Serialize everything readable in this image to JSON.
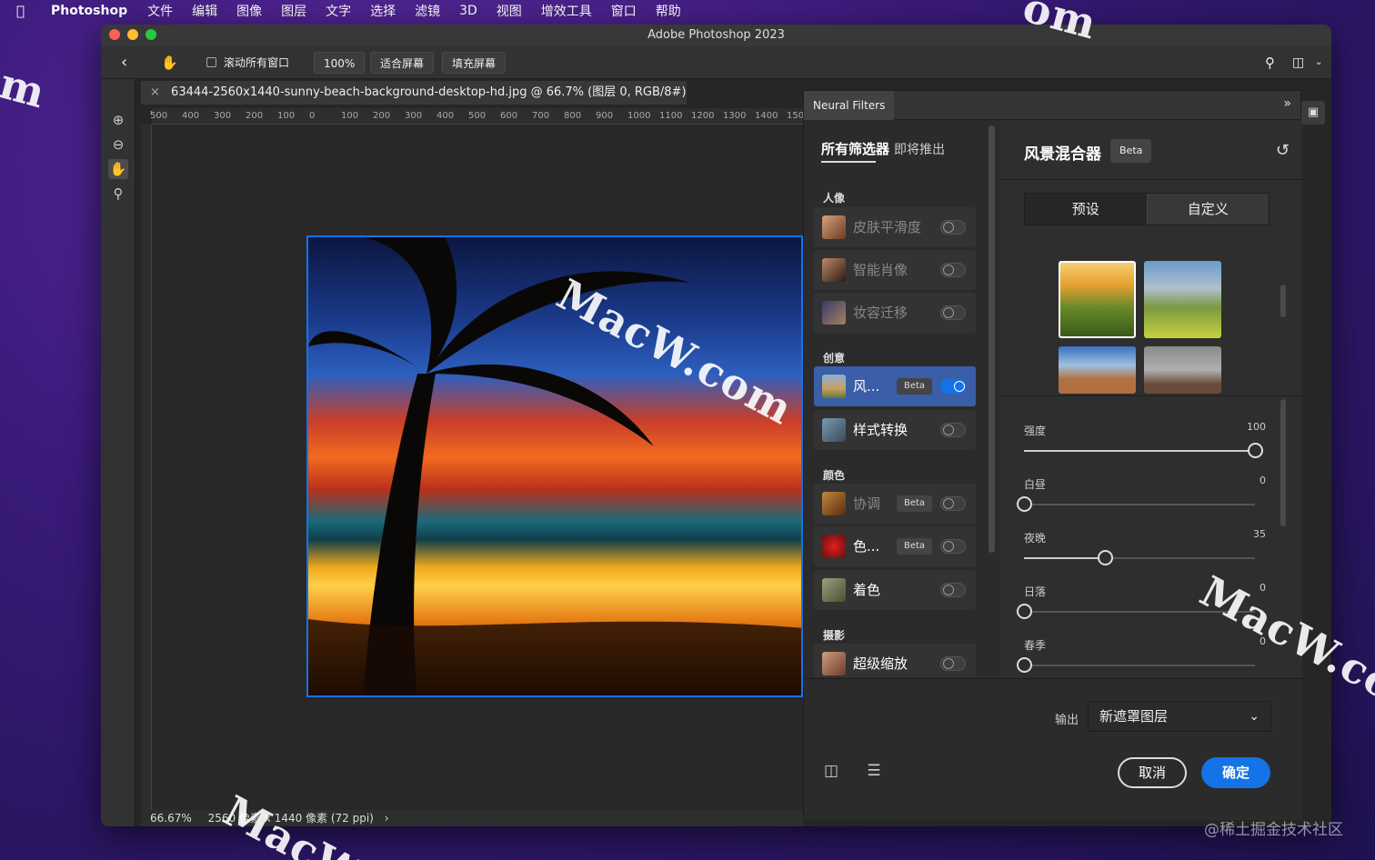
{
  "menubar": {
    "app": "Photoshop",
    "items": [
      "文件",
      "编辑",
      "图像",
      "图层",
      "文字",
      "选择",
      "滤镜",
      "3D",
      "视图",
      "增效工具",
      "窗口",
      "帮助"
    ]
  },
  "window": {
    "title": "Adobe Photoshop 2023"
  },
  "options": {
    "scroll_all": "滚动所有窗口",
    "zoom": "100%",
    "fit_screen": "适合屏幕",
    "fill_screen": "填充屏幕"
  },
  "document": {
    "tab": "63444-2560x1440-sunny-beach-background-desktop-hd.jpg @ 66.7% (图层 0, RGB/8#) *",
    "ruler_ticks": [
      "500",
      "400",
      "300",
      "200",
      "100",
      "0",
      "100",
      "200",
      "300",
      "400",
      "500",
      "600",
      "700",
      "800",
      "900",
      "1000",
      "1100",
      "1200",
      "1300",
      "1400",
      "150"
    ],
    "status_zoom": "66.67%",
    "status_info": "2560 像素 x 1440 像素 (72 ppi)"
  },
  "neural": {
    "panel_title": "Neural Filters",
    "tab_all": "所有筛选器",
    "tab_soon": "即将推出",
    "categories": {
      "portrait": "人像",
      "creative": "创意",
      "color": "颜色",
      "photo": "摄影"
    },
    "filters": [
      {
        "label": "皮肤平滑度",
        "on": false
      },
      {
        "label": "智能肖像",
        "on": false
      },
      {
        "label": "妆容迁移",
        "on": false
      },
      {
        "label": "风...",
        "beta": "Beta",
        "on": true
      },
      {
        "label": "样式转换",
        "on": false
      },
      {
        "label": "协调",
        "beta": "Beta",
        "on": false
      },
      {
        "label": "色...",
        "beta": "Beta",
        "on": false
      },
      {
        "label": "着色",
        "on": false
      },
      {
        "label": "超级缩放",
        "on": false
      }
    ],
    "detail": {
      "title": "风景混合器",
      "beta": "Beta",
      "seg_preset": "预设",
      "seg_custom": "自定义",
      "sliders": [
        {
          "label": "强度",
          "value": "100",
          "fraction": 1.0
        },
        {
          "label": "白昼",
          "value": "0",
          "fraction": 0.0
        },
        {
          "label": "夜晚",
          "value": "35",
          "fraction": 0.35
        },
        {
          "label": "日落",
          "value": "0",
          "fraction": 0.0
        },
        {
          "label": "春季",
          "value": "0",
          "fraction": 0.0
        }
      ]
    },
    "output_label": "输出",
    "output_value": "新遮罩图层",
    "cancel": "取消",
    "ok": "确定"
  },
  "watermarks": [
    "MacW.com",
    "MacW.co",
    "MacW",
    "om",
    "m"
  ],
  "credit": "@稀土掘金技术社区",
  "colors": {
    "accent": "#1473e6"
  }
}
